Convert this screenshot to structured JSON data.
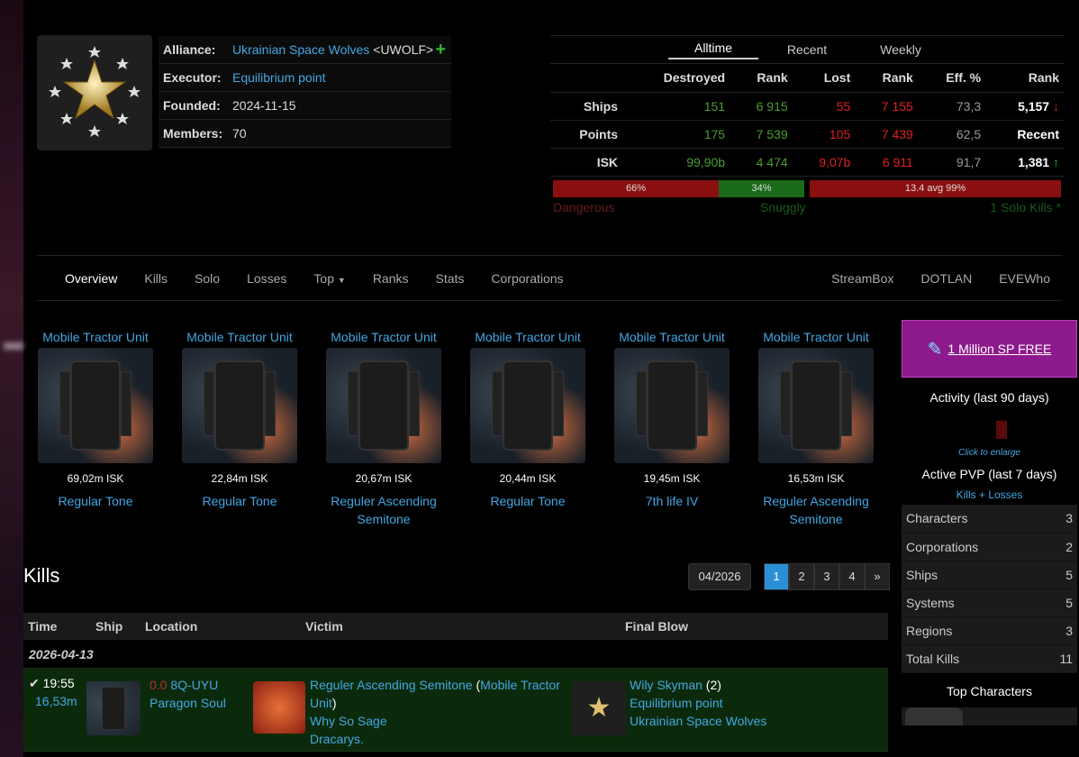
{
  "header": {
    "alliance_label": "Alliance:",
    "alliance": "Ukrainian Space Wolves",
    "ticker": "<UWOLF>",
    "executor_label": "Executor:",
    "executor": "Equilibrium point",
    "founded_label": "Founded:",
    "founded": "2024-11-15",
    "members_label": "Members:",
    "members": "70"
  },
  "stats": {
    "tabs": [
      "Alltime",
      "Recent",
      "Weekly"
    ],
    "cols": [
      "Destroyed",
      "Rank",
      "Lost",
      "Rank",
      "Eff. %",
      "Rank"
    ],
    "rows": [
      {
        "label": "Ships",
        "destroyed": "151",
        "rank": "6 915",
        "lost": "55",
        "lrank": "7 155",
        "eff": "73,3",
        "r": "5,157"
      },
      {
        "label": "Points",
        "destroyed": "175",
        "rank": "7 539",
        "lost": "105",
        "lrank": "7 439",
        "eff": "62,5",
        "r": "Recent"
      },
      {
        "label": "ISK",
        "destroyed": "99,90b",
        "rank": "4 474",
        "lost": "9,07b",
        "lrank": "6 911",
        "eff": "91,7",
        "r": "1,381"
      }
    ],
    "bar1_red": "66%",
    "bar1_green": "34%",
    "bar2": "13.4 avg 99%",
    "danger": "Dangerous",
    "snuggly": "Snuggly",
    "solo": "1 Solo Kills *"
  },
  "nav": {
    "left": [
      "Overview",
      "Kills",
      "Solo",
      "Losses",
      "Top",
      "Ranks",
      "Stats",
      "Corporations"
    ],
    "right": [
      "StreamBox",
      "DOTLAN",
      "EVEWho"
    ]
  },
  "top_items": [
    {
      "title": "Mobile Tractor Unit",
      "isk": "69,02m ISK",
      "name": "Regular Tone"
    },
    {
      "title": "Mobile Tractor Unit",
      "isk": "22,84m ISK",
      "name": "Regular Tone"
    },
    {
      "title": "Mobile Tractor Unit",
      "isk": "20,67m ISK",
      "name": "Reguler Ascending Semitone"
    },
    {
      "title": "Mobile Tractor Unit",
      "isk": "20,44m ISK",
      "name": "Regular Tone"
    },
    {
      "title": "Mobile Tractor Unit",
      "isk": "19,45m ISK",
      "name": "7th life IV"
    },
    {
      "title": "Mobile Tractor Unit",
      "isk": "16,53m ISK",
      "name": "Reguler Ascending Semitone"
    }
  ],
  "sidebar": {
    "promo": "1 Million SP FREE",
    "activity": "Activity (last 90 days)",
    "enlarge": "Click to enlarge",
    "pvp": "Active PVP (last 7 days)",
    "kl": "Kills + Losses",
    "rows": [
      {
        "k": "Characters",
        "v": "3"
      },
      {
        "k": "Corporations",
        "v": "2"
      },
      {
        "k": "Ships",
        "v": "5"
      },
      {
        "k": "Systems",
        "v": "5"
      },
      {
        "k": "Regions",
        "v": "3"
      },
      {
        "k": "Total Kills",
        "v": "11"
      }
    ],
    "top": "Top Characters"
  },
  "kills": {
    "title": "Kills",
    "month": "04/2026",
    "pages": [
      "1",
      "2",
      "3",
      "4",
      "»"
    ],
    "cols": [
      "Time",
      "Ship",
      "Location",
      "Victim",
      "Final Blow"
    ],
    "date": "2026-04-13",
    "row": {
      "time": "19:55",
      "value": "16,53m",
      "sec": "0.0",
      "system": "8Q-UYU",
      "region": "Paragon Soul",
      "victim": "Reguler Ascending Semitone",
      "victim_ship": "Mobile Tractor Unit",
      "victim_corp": "Why So Sage",
      "victim_all": "Dracarys.",
      "fb": "Wily Skyman",
      "fb_count": "(2)",
      "fb_corp": "Equilibrium point",
      "fb_all": "Ukrainian Space Wolves"
    }
  }
}
